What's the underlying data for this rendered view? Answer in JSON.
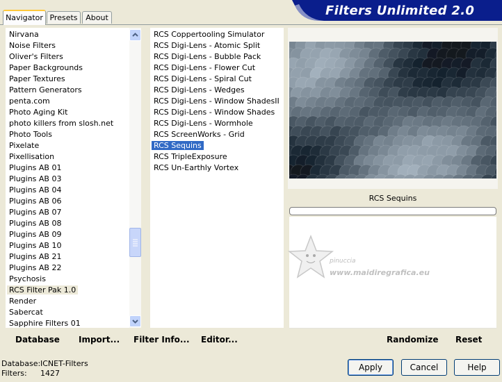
{
  "app_title": "Filters Unlimited 2.0",
  "tabs": [
    {
      "label": "Navigator",
      "active": true
    },
    {
      "label": "Presets",
      "active": false
    },
    {
      "label": "About",
      "active": false
    }
  ],
  "categories": [
    "Nirvana",
    "Noise Filters",
    "Oliver's Filters",
    "Paper Backgrounds",
    "Paper Textures",
    "Pattern Generators",
    "penta.com",
    "Photo Aging Kit",
    "photo killers from slosh.net",
    "Photo Tools",
    "Pixelate",
    "Pixellisation",
    "Plugins AB 01",
    "Plugins AB 03",
    "Plugins AB 04",
    "Plugins AB 06",
    "Plugins AB 07",
    "Plugins AB 08",
    "Plugins AB 09",
    "Plugins AB 10",
    "Plugins AB 21",
    "Plugins AB 22",
    "Psychosis",
    "RCS Filter Pak 1.0",
    "Render",
    "Sabercat",
    "Sapphire Filters 01"
  ],
  "selected_category": "RCS Filter Pak 1.0",
  "filters": [
    "RCS Coppertooling Simulator",
    "RCS Digi-Lens - Atomic Split",
    "RCS Digi-Lens - Bubble Pack",
    "RCS Digi-Lens - Flower Cut",
    "RCS Digi-Lens - Spiral Cut",
    "RCS Digi-Lens - Wedges",
    "RCS Digi-Lens - Window ShadesII",
    "RCS Digi-Lens - Window Shades",
    "RCS Digi-Lens - Wormhole",
    "RCS ScreenWorks - Grid",
    "RCS Sequins",
    "RCS TripleExposure",
    "RCS Un-Earthly Vortex"
  ],
  "selected_filter": "RCS Sequins",
  "preview_filter_name": "RCS Sequins",
  "watermark": {
    "line1": "pinuccia",
    "line2": "www.maidiregrafica.eu"
  },
  "left_buttons": {
    "database": "Database",
    "import": "Import...",
    "filter_info": "Filter Info...",
    "editor": "Editor..."
  },
  "right_buttons": {
    "randomize": "Randomize",
    "reset": "Reset"
  },
  "status": {
    "database_label": "Database:",
    "database_value": "ICNET-Filters",
    "filters_label": "Filters:",
    "filters_value": "1427"
  },
  "dialog_buttons": {
    "apply": "Apply",
    "cancel": "Cancel",
    "help": "Help"
  },
  "colors": {
    "selection_blue": "#316ac5",
    "banner_navy": "#0a1e8c",
    "preview_base": "#5a6f7e"
  },
  "icons": {
    "scroll_up": "chevron-up-icon",
    "scroll_down": "chevron-down-icon",
    "scroll_grip": "grip-icon",
    "watermark_star": "star-icon"
  }
}
